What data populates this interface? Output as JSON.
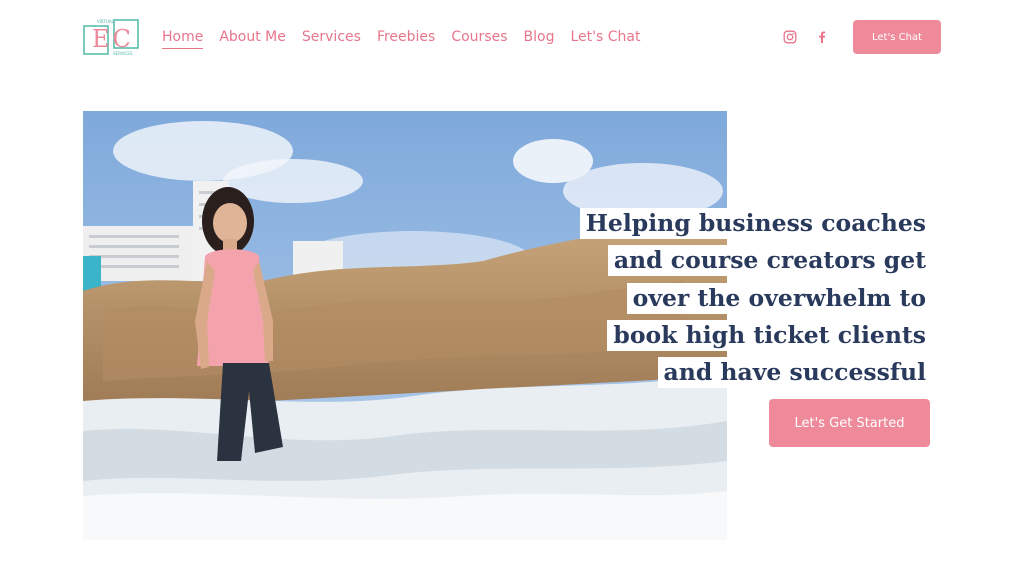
{
  "brand": {
    "logo_letters": "EC",
    "logo_top_text": "VIRTUAL",
    "logo_bottom_text": "SERVICES",
    "accent_color": "#ee8a9a",
    "teal_color": "#4fb8a8"
  },
  "nav": {
    "items": [
      {
        "label": "Home",
        "active": true
      },
      {
        "label": "About Me"
      },
      {
        "label": "Services"
      },
      {
        "label": "Freebies"
      },
      {
        "label": "Courses"
      },
      {
        "label": "Blog"
      },
      {
        "label": "Let's Chat"
      }
    ]
  },
  "social": {
    "icons": [
      "instagram-icon",
      "facebook-icon"
    ]
  },
  "header_cta": {
    "label": "Let's Chat"
  },
  "hero": {
    "headline": "Helping business coaches and course creators get over the overwhelm to book high ticket clients and have successful launches!",
    "button_label": "Let's Get Started"
  }
}
